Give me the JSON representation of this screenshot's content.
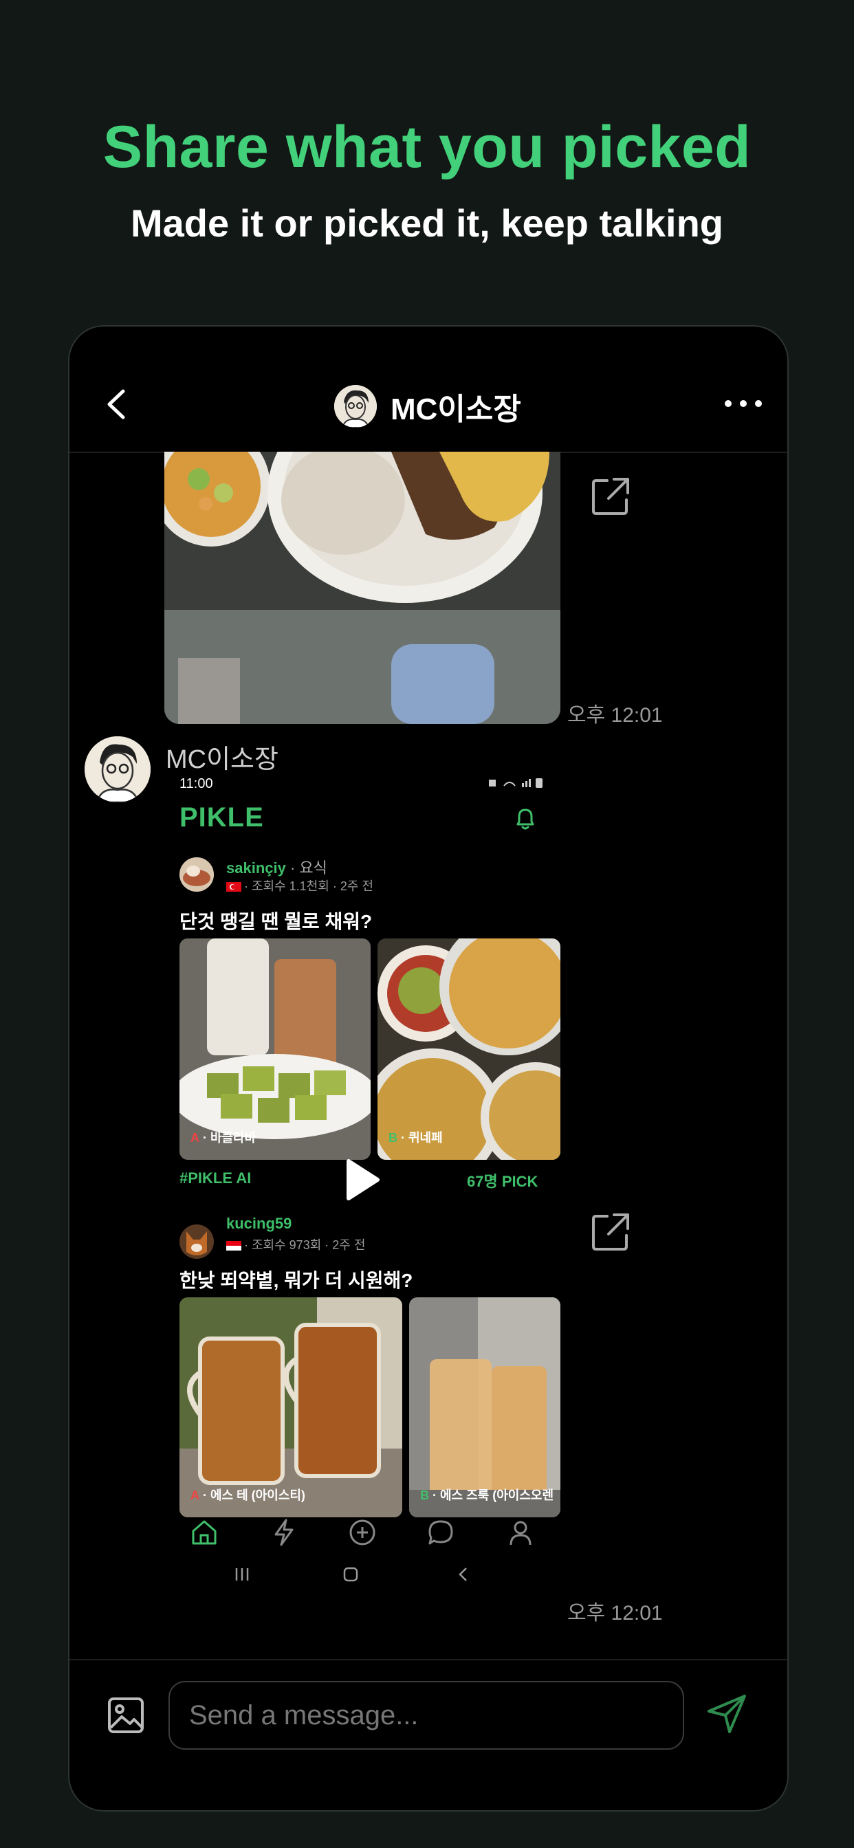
{
  "hero": {
    "title": "Share what you picked",
    "subtitle": "Made it or picked it, keep talking"
  },
  "chat": {
    "title": "MC이소장",
    "sender_name": "MC이소장",
    "message_time_1": "오후 12:01",
    "message_time_2": "오후 12:01",
    "input_placeholder": "Send a message...",
    "icons": {
      "back": "chevron-left-icon",
      "more": "more-dots-icon",
      "share": "external-share-icon",
      "image": "image-icon",
      "send": "send-icon"
    }
  },
  "screenshot": {
    "status_time": "11:00",
    "brand": "PIKLE",
    "post1": {
      "username": "sakinçiy",
      "category": " · 요식",
      "meta": "· 조회수 1.1천회 · 2주 전",
      "question": "단것 땡길 땐 뭘로 채워?",
      "option_a_letter": "A",
      "option_a": " · 바클라바",
      "option_b_letter": "B",
      "option_b": " · 퀴네페",
      "tag": "#PIKLE AI",
      "pick_count": "67명 PICK"
    },
    "post2": {
      "username": "kucing59",
      "meta": "· 조회수 973회 · 2주 전",
      "question": "한낮 뙤약볕, 뭐가 더 시원해?",
      "option_a_letter": "A",
      "option_a": " · 에스 테 (아이스티)",
      "option_b_letter": "B",
      "option_b": " · 에스 즈룩 (아이스오렌"
    }
  },
  "colors": {
    "accent": "#42d17a",
    "background": "#121815",
    "phone": "#000000"
  }
}
